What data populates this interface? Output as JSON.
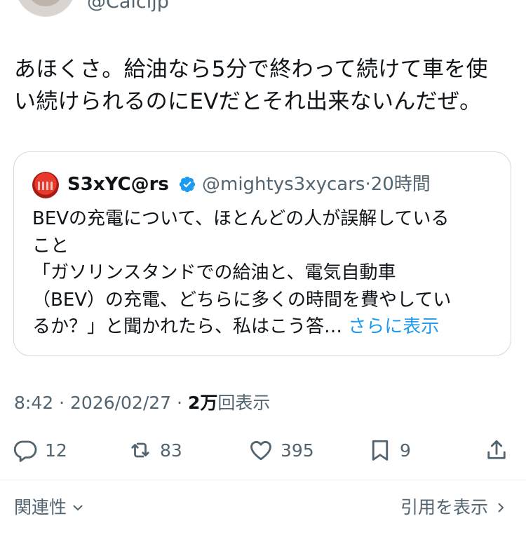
{
  "author": {
    "handle": "@Calcljp"
  },
  "tweet": {
    "text": "あほくさ。給油なら5分で終わって続けて車を使\nい続けられるのにEVだとそれ出来ないんだぜ。"
  },
  "quoted": {
    "name": "S3xYC@rs",
    "handle": "@mightys3xycars",
    "separator": "·",
    "time": "20時間",
    "text": "BEVの充電について、ほとんどの人が誤解している\nこと\n「ガソリンスタンドでの給油と、電気自動車\n（BEV）の充電、どちらに多くの時間を費やしてい\nるか？」と聞かれたら、私はこう答… ",
    "more_label": "さらに表示",
    "verified_color": "#1d9bf0"
  },
  "meta": {
    "time": "8:42",
    "separator": "·",
    "date": "2026/02/27",
    "views_count": "2万",
    "views_label": "回表示"
  },
  "actions": {
    "replies": "12",
    "reposts": "83",
    "likes": "395",
    "bookmarks": "9"
  },
  "footer": {
    "related_label": "関連性",
    "quotes_label": "引用を表示"
  },
  "colors": {
    "text": "#0f1419",
    "secondary": "#536471",
    "link": "#1d9bf0",
    "border": "#cfd9de"
  }
}
